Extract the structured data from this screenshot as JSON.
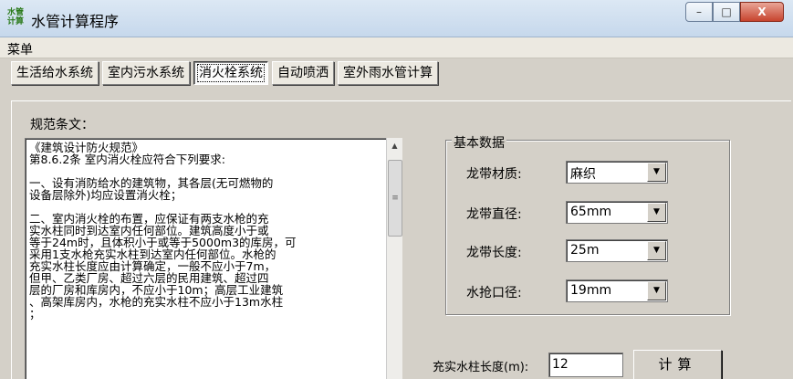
{
  "window": {
    "title": "水管计算程序",
    "icon_text": "水管\n计算",
    "controls": {
      "minimize": "–",
      "maximize": "□",
      "close": "X"
    }
  },
  "menu": {
    "label": "菜单"
  },
  "tabs": [
    {
      "label": "生活给水系统",
      "active": false
    },
    {
      "label": "室内污水系统",
      "active": false
    },
    {
      "label": "消火栓系统",
      "active": true
    },
    {
      "label": "自动喷洒",
      "active": false
    },
    {
      "label": "室外雨水管计算",
      "active": false
    }
  ],
  "spec": {
    "label": "规范条文：",
    "text": "《建筑设计防火规范》\n第8.6.2条 室内消火栓应符合下列要求:\n\n一、设有消防给水的建筑物，其各层(无可燃物的\n设备层除外)均应设置消火栓；\n\n二、室内消火栓的布置，应保证有两支水枪的充\n实水柱同时到达室内任何部位。建筑高度小于或\n等于24m时，且体积小于或等于5000m3的库房，可\n采用1支水枪充实水柱到达室内任何部位。水枪的\n充实水柱长度应由计算确定，一般不应小于7m，\n但甲、乙类厂房、超过六层的民用建筑、超过四\n层的厂房和库房内，不应小于10m；高层工业建筑\n、高架库房内，水枪的充实水柱不应小于13m水柱\n；"
  },
  "basic_data": {
    "title": "基本数据",
    "hose_material": {
      "label": "龙带材质:",
      "value": "麻织"
    },
    "hose_diameter": {
      "label": "龙带直径:",
      "value": "65mm"
    },
    "hose_length": {
      "label": "龙带长度:",
      "value": "25m"
    },
    "nozzle_diameter": {
      "label": "水抢口径:",
      "value": "19mm"
    }
  },
  "result": {
    "label": "充实水柱长度(m):",
    "value": "12",
    "calc_button": "计算"
  }
}
